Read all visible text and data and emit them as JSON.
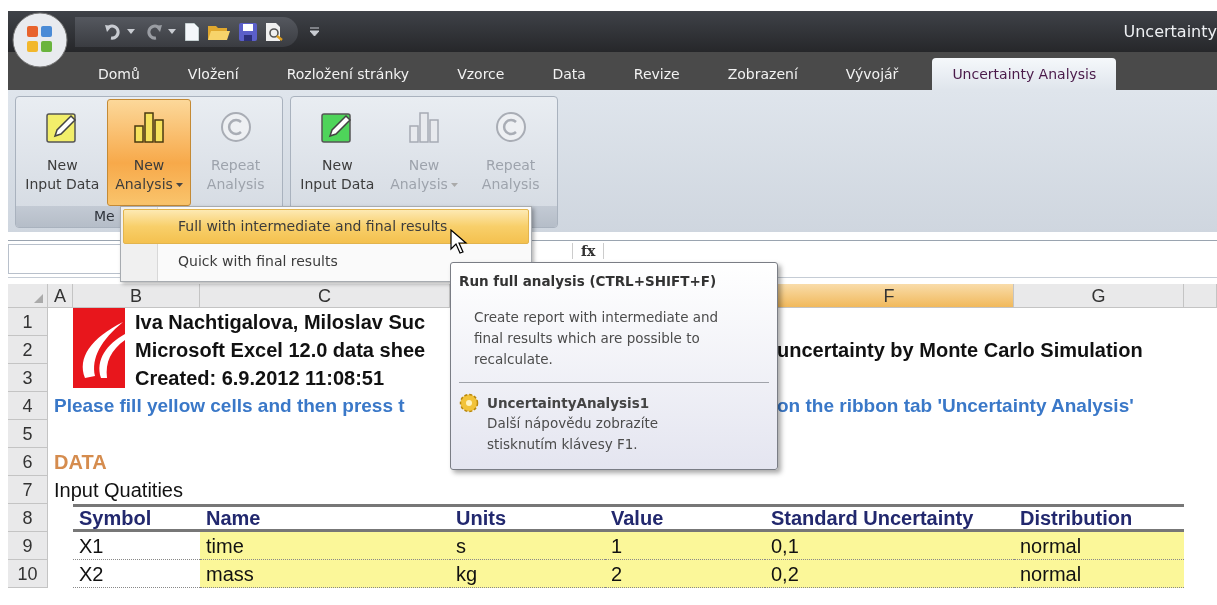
{
  "title_bar": {
    "title": "Uncertainty"
  },
  "tabs": [
    {
      "label": "Domů",
      "selected": false
    },
    {
      "label": "Vložení",
      "selected": false
    },
    {
      "label": "Rozložení stránky",
      "selected": false
    },
    {
      "label": "Vzorce",
      "selected": false
    },
    {
      "label": "Data",
      "selected": false
    },
    {
      "label": "Revize",
      "selected": false
    },
    {
      "label": "Zobrazení",
      "selected": false
    },
    {
      "label": "Vývojář",
      "selected": false
    },
    {
      "label": "Uncertainty Analysis",
      "selected": true
    }
  ],
  "ribbon": {
    "groups": [
      {
        "label": "Me",
        "buttons": [
          {
            "kind": "input",
            "lines": [
              "New",
              "Input Data"
            ],
            "color": "#f2ee6a",
            "disabled": false,
            "pressed": false,
            "dropdown": false
          },
          {
            "kind": "analysis",
            "lines": [
              "New",
              "Analysis"
            ],
            "disabled": false,
            "pressed": true,
            "dropdown": true
          },
          {
            "kind": "repeat",
            "lines": [
              "Repeat",
              "Analysis"
            ],
            "disabled": true,
            "pressed": false,
            "dropdown": false
          }
        ]
      },
      {
        "buttons": [
          {
            "kind": "input",
            "lines": [
              "New",
              "Input Data"
            ],
            "color": "#4ed45a",
            "disabled": false,
            "pressed": false,
            "dropdown": false
          },
          {
            "kind": "analysis",
            "lines": [
              "New",
              "Analysis"
            ],
            "disabled": true,
            "pressed": false,
            "dropdown": true
          },
          {
            "kind": "repeat",
            "lines": [
              "Repeat",
              "Analysis"
            ],
            "disabled": true,
            "pressed": false,
            "dropdown": false
          }
        ]
      }
    ]
  },
  "menu": {
    "items": [
      {
        "label": "Full with intermediate and final results",
        "selected": true
      },
      {
        "label": "Quick with final results",
        "selected": false
      }
    ]
  },
  "formula_bar": {
    "fx": "fx"
  },
  "columns": [
    {
      "label": "A",
      "selected": false
    },
    {
      "label": "B",
      "selected": false
    },
    {
      "label": "C",
      "selected": false
    },
    {
      "label": "F",
      "selected": true
    },
    {
      "label": "G",
      "selected": false
    }
  ],
  "row_numbers": [
    "1",
    "2",
    "3",
    "4",
    "5",
    "6",
    "7",
    "8",
    "9",
    "10"
  ],
  "sheet": {
    "header_lines": [
      "Iva Nachtigalova, Miloslav Suc",
      "Microsoft Excel 12.0 data shee",
      "Created: 6.9.2012 11:08:51"
    ],
    "title_right": "uncertainty by Monte Carlo Simulation",
    "instruction_left": "Please fill yellow cells and then press t",
    "instruction_right": "on the ribbon tab 'Uncertainty Analysis'",
    "section": "DATA",
    "subtitle": "Input Quatities",
    "table": {
      "columns": [
        "Symbol",
        "Name",
        "Units",
        "Value",
        "Standard Uncertainty",
        "Distribution"
      ],
      "rows": [
        {
          "cells": [
            "X1",
            "time",
            "s",
            "1",
            "0,1",
            "normal"
          ]
        },
        {
          "cells": [
            "X2",
            "mass",
            "kg",
            "2",
            "0,2",
            "normal"
          ]
        }
      ]
    }
  },
  "tooltip": {
    "title": "Run full analysis (CTRL+SHIFT+F)",
    "description": "Create report with intermediate and final results which are possible to recalculate.",
    "addin": "UncertaintyAnalysis1",
    "help": "Další nápovědu zobrazíte stisknutím klávesy F1."
  }
}
